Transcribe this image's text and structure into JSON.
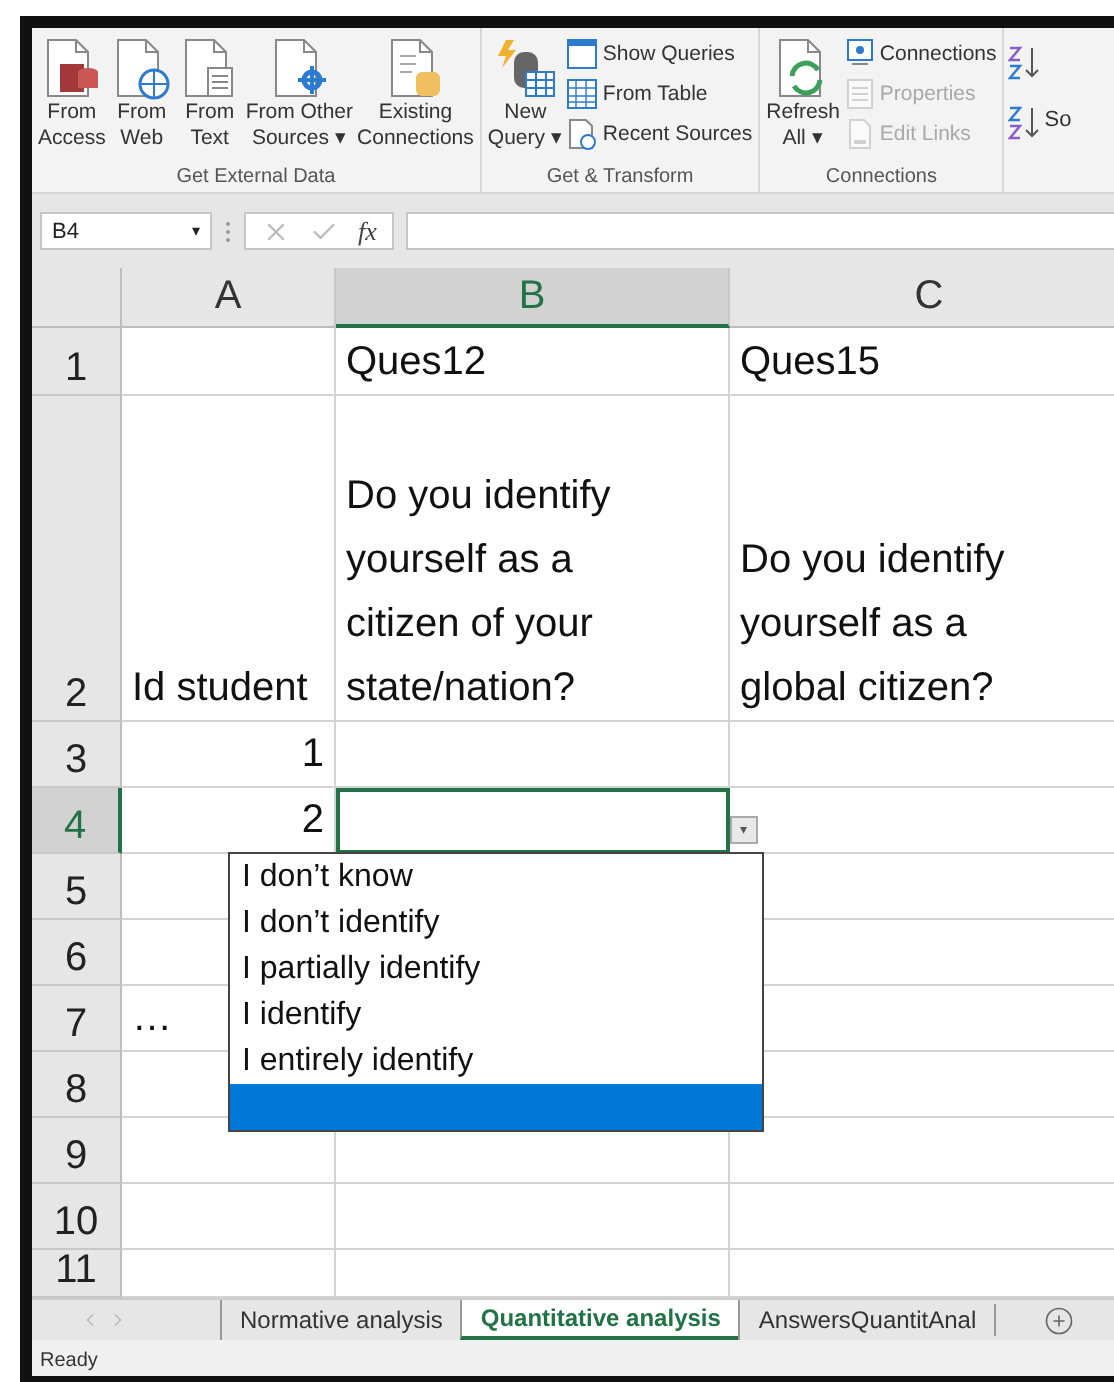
{
  "ribbon": {
    "groups": [
      {
        "label": "Get External Data",
        "items": [
          {
            "kind": "large",
            "label": "From\nAccess"
          },
          {
            "kind": "large",
            "label": "From\nWeb"
          },
          {
            "kind": "large",
            "label": "From\nText"
          },
          {
            "kind": "large",
            "label": "From Other\nSources",
            "caret": "▾"
          },
          {
            "kind": "large",
            "label": "Existing\nConnections"
          }
        ]
      },
      {
        "label": "Get & Transform",
        "items": [
          {
            "kind": "large",
            "label": "New\nQuery",
            "caret": "▾"
          },
          {
            "kind": "small",
            "label": "Show Queries",
            "disabled": false
          },
          {
            "kind": "small",
            "label": "From Table",
            "disabled": false
          },
          {
            "kind": "small",
            "label": "Recent Sources",
            "disabled": false
          }
        ]
      },
      {
        "label": "Connections",
        "items": [
          {
            "kind": "large",
            "label": "Refresh\nAll",
            "caret": "▾"
          },
          {
            "kind": "small",
            "label": "Connections",
            "disabled": false
          },
          {
            "kind": "small",
            "label": "Properties",
            "disabled": true
          },
          {
            "kind": "small",
            "label": "Edit Links",
            "disabled": true
          }
        ]
      }
    ],
    "cut_group": {
      "label": "So"
    }
  },
  "formula_bar": {
    "name_box": "B4",
    "name_box_caret": "▾",
    "fx": "fx"
  },
  "sheet": {
    "columns": [
      {
        "label": "A",
        "selected": false
      },
      {
        "label": "B",
        "selected": true
      },
      {
        "label": "C",
        "selected": false
      }
    ],
    "rows": [
      {
        "label": "1",
        "selected": false,
        "cells": [
          "",
          "Ques12",
          "Ques15"
        ]
      },
      {
        "label": "2",
        "selected": false,
        "cells": [
          "Id student",
          "Do you identify yourself as a citizen of your state/nation?",
          "Do you identify yourself as a global citizen?"
        ]
      },
      {
        "label": "3",
        "selected": false,
        "cells": [
          "1",
          "",
          ""
        ]
      },
      {
        "label": "4",
        "selected": true,
        "cells": [
          "2",
          "",
          ""
        ]
      },
      {
        "label": "5",
        "selected": false,
        "cells": [
          "",
          "",
          ""
        ]
      },
      {
        "label": "6",
        "selected": false,
        "cells": [
          "",
          "",
          ""
        ]
      },
      {
        "label": "7",
        "selected": false,
        "cells": [
          "…",
          "",
          ""
        ]
      },
      {
        "label": "8",
        "selected": false,
        "cells": [
          "",
          "",
          ""
        ]
      },
      {
        "label": "9",
        "selected": false,
        "cells": [
          "",
          "",
          ""
        ]
      },
      {
        "label": "10",
        "selected": false,
        "cells": [
          "",
          "",
          ""
        ]
      },
      {
        "label": "11",
        "selected": false,
        "cells": [
          "",
          "",
          ""
        ]
      }
    ],
    "dropdown": {
      "button": "▾",
      "options": [
        {
          "label": "I don’t know",
          "selected": false
        },
        {
          "label": "I don’t identify",
          "selected": false
        },
        {
          "label": "I partially identify",
          "selected": false
        },
        {
          "label": "I identify",
          "selected": false
        },
        {
          "label": "I entirely identify",
          "selected": false
        },
        {
          "selected": true
        }
      ]
    }
  },
  "sheet_tabs": [
    {
      "label": "Normative analysis",
      "selected": false
    },
    {
      "label": "Quantitative analysis",
      "selected": true
    },
    {
      "label": "AnswersQuantitAnal",
      "selected": false
    }
  ],
  "status_bar": {
    "text": "Ready"
  }
}
